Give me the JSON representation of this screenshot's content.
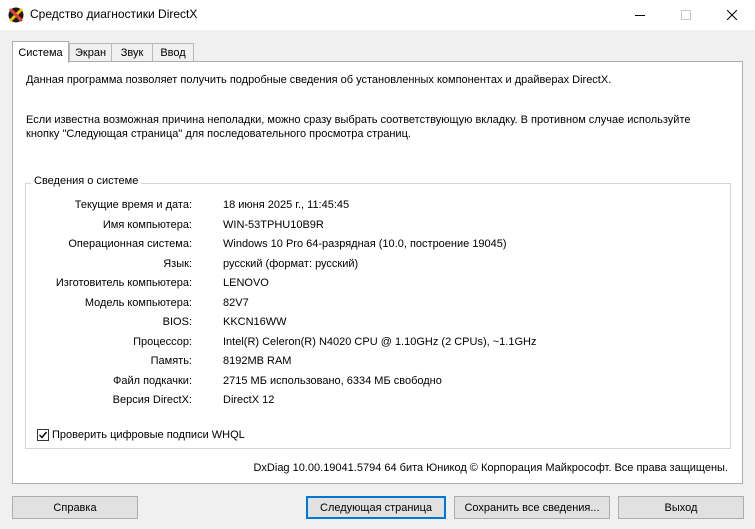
{
  "window": {
    "title": "Средство диагностики DirectX"
  },
  "tabs": [
    {
      "label": "Система",
      "active": true
    },
    {
      "label": "Экран",
      "active": false
    },
    {
      "label": "Звук",
      "active": false
    },
    {
      "label": "Ввод",
      "active": false
    }
  ],
  "intro": {
    "line1": "Данная программа позволяет получить подробные сведения об установленных компонентах и драйверах DirectX.",
    "line2": "Если известна возможная причина неполадки, можно сразу выбрать соответствующую вкладку. В противном случае используйте кнопку \"Следующая страница\" для последовательного просмотра страниц."
  },
  "system_info": {
    "group_title": "Сведения о системе",
    "rows": [
      {
        "label": "Текущие время и дата:",
        "value": "18 июня 2025 г., 11:45:45"
      },
      {
        "label": "Имя компьютера:",
        "value": "WIN-53TPHU10B9R"
      },
      {
        "label": "Операционная система:",
        "value": "Windows 10 Pro 64-разрядная (10.0, построение 19045)"
      },
      {
        "label": "Язык:",
        "value": "русский (формат: русский)"
      },
      {
        "label": "Изготовитель компьютера:",
        "value": "LENOVO"
      },
      {
        "label": "Модель компьютера:",
        "value": "82V7"
      },
      {
        "label": "BIOS:",
        "value": "KKCN16WW"
      },
      {
        "label": "Процессор:",
        "value": "Intel(R) Celeron(R) N4020 CPU @ 1.10GHz (2 CPUs), ~1.1GHz"
      },
      {
        "label": "Память:",
        "value": "8192MB RAM"
      },
      {
        "label": "Файл подкачки:",
        "value": "2715 МБ использовано, 6334 МБ свободно"
      },
      {
        "label": "Версия DirectX:",
        "value": "DirectX 12"
      }
    ]
  },
  "whql": {
    "label": "Проверить цифровые подписи WHQL",
    "checked": true
  },
  "footer": "DxDiag 10.00.19041.5794 64 бита Юникод © Корпорация Майкрософт. Все права защищены.",
  "buttons": {
    "help": "Справка",
    "next": "Следующая страница",
    "save": "Сохранить все сведения...",
    "exit": "Выход"
  },
  "icons": {
    "app": "directx-icon",
    "minimize": "minimize-icon",
    "maximize": "maximize-icon",
    "close": "close-icon",
    "check": "checkmark-icon"
  }
}
